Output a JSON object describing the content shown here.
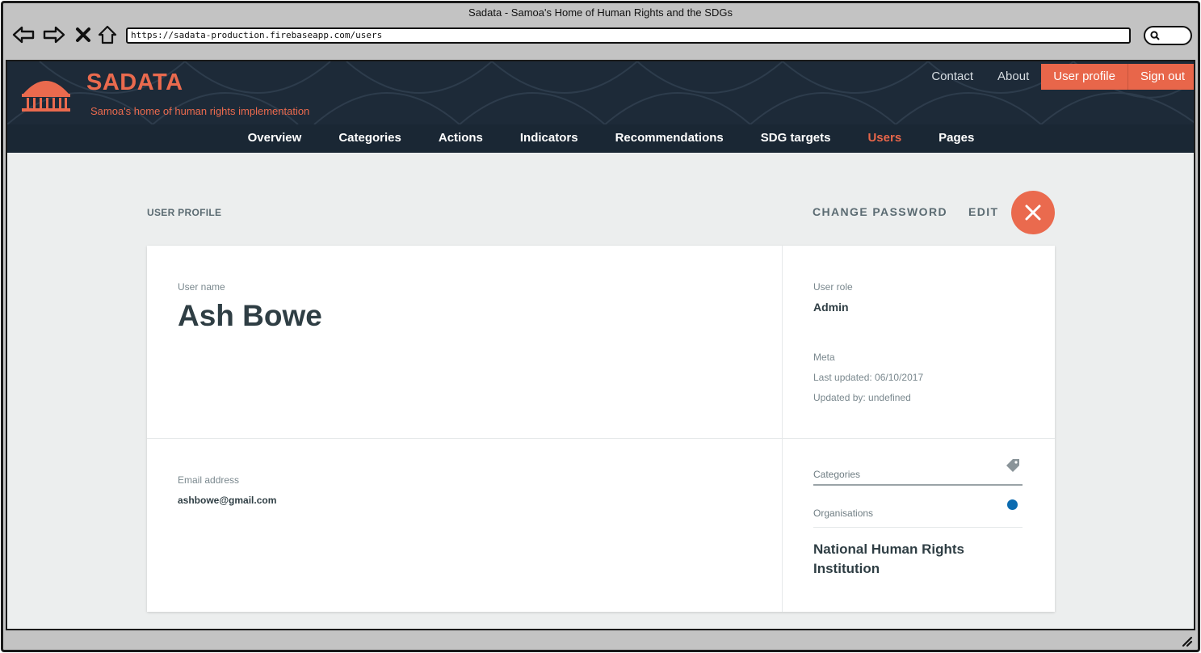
{
  "browser": {
    "title": "Sadata - Samoa's Home of Human Rights and the SDGs",
    "url": "https://sadata-production.firebaseapp.com/users"
  },
  "header": {
    "brand": "SADATA",
    "tagline": "Samoa's home of human rights implementation",
    "top_links": [
      "Contact",
      "About",
      "User profile",
      "Sign out"
    ],
    "nav": [
      "Overview",
      "Categories",
      "Actions",
      "Indicators",
      "Recommendations",
      "SDG targets",
      "Users",
      "Pages"
    ],
    "active_nav": "Users"
  },
  "page": {
    "label": "USER PROFILE",
    "change_password": "CHANGE PASSWORD",
    "edit": "EDIT"
  },
  "profile": {
    "user_name_label": "User name",
    "user_name": "Ash Bowe",
    "role_label": "User role",
    "role": "Admin",
    "meta_label": "Meta",
    "last_updated": "Last updated: 06/10/2017",
    "updated_by": "Updated by: undefined",
    "email_label": "Email address",
    "email": "ashbowe@gmail.com",
    "categories_label": "Categories",
    "organisations_label": "Organisations",
    "organisation": "National Human Rights Institution"
  },
  "colors": {
    "accent": "#e8664a",
    "header_bg": "#1d2a38",
    "org_dot": "#0b6bb0"
  },
  "icons": {
    "back": "back-arrow-icon",
    "forward": "forward-arrow-icon",
    "stop": "close-x-icon",
    "home": "home-icon",
    "search": "search-icon",
    "logo": "fale-house-logo",
    "close": "close-icon",
    "tag": "tag-icon"
  }
}
